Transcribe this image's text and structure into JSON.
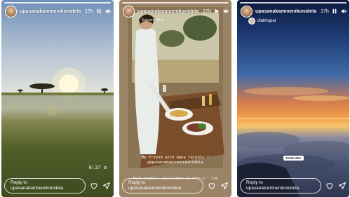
{
  "stories": [
    {
      "username": "upasanakaminenikonidela",
      "time": "17h",
      "reply_line1": "Reply to",
      "reply_line2": "upasanakaminenikonidela",
      "timestamp_overlay": "6:37 a"
    },
    {
      "username": "upasanakaminenikonidela",
      "time": "17h",
      "sticker_text": "Sunset_Tid",
      "caption_line1": "My friend with many talents !",
      "caption_line2": "@upasanakaminenikonidela",
      "reply_line1": "Reply to",
      "reply_line2": "upasanakaminenikonidela",
      "overlay_text": "Much needed...palliation in Africa ! Yum"
    },
    {
      "username": "upasanakaminenikonidela",
      "time": "17h",
      "mention": "diabhupal",
      "tag_label": "TANZANIA",
      "reply_line1": "Reply to",
      "reply_line2": "upasanakaminenikonidela"
    }
  ],
  "icons": {
    "pause": "pause-icon",
    "mute": "speaker-muted-icon",
    "heart": "heart-icon",
    "send": "send-icon",
    "play": "play-icon"
  }
}
